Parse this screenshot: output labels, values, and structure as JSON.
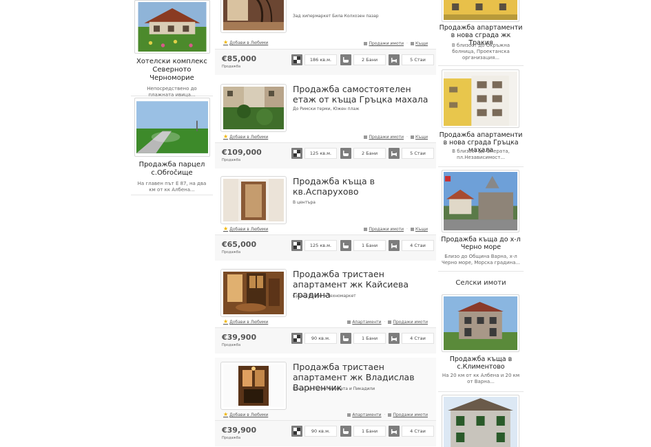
{
  "left_sidebar": [
    {
      "title": "Хотелски комплекс Северното Черноморие",
      "desc": "Непосредствено до плажната ивица..."
    },
    {
      "title": "Продажба парцел с.Обročище",
      "desc": "На главен път Е 87, на два км от кк Албена..."
    }
  ],
  "listings": [
    {
      "title": "",
      "desc": "Зад хипермаркет Била Колхозен пазар",
      "fav": "Добави в Любими",
      "cats": [
        "Продажи имоти",
        "Къщи"
      ],
      "price": "€85,000",
      "price_type": "Продажба",
      "area": "186 кв.м.",
      "baths": "2 Бани",
      "rooms": "5 Стаи"
    },
    {
      "title": "Продажба самостоятелен етаж от къща Гръцка махала",
      "desc": "До Римски терми, Южен плаж",
      "fav": "Добави в Любими",
      "cats": [
        "Продажи имоти",
        "Къщи"
      ],
      "price": "€109,000",
      "price_type": "Продажба",
      "area": "125 кв.м.",
      "baths": "2 Бани",
      "rooms": "5 Стаи"
    },
    {
      "title": "Продажба къща в кв.Аспарухово",
      "desc": "В центъра",
      "fav": "Добави в Любими",
      "cats": [
        "Продажи имоти",
        "Къщи"
      ],
      "price": "€65,000",
      "price_type": "Продажба",
      "area": "125 кв.м.",
      "baths": "1 Бани",
      "rooms": "4 Стаи"
    },
    {
      "title": "Продажба тристаен апартамент жк Кайсиева градина",
      "desc": "Срещу Метро и Техномаркет",
      "fav": "Добави в Любими",
      "cats": [
        "Апартаменти",
        "Продажи имоти"
      ],
      "price": "€39,900",
      "price_type": "Продажба",
      "area": "90 кв.м.",
      "baths": "1 Бани",
      "rooms": "4 Стаи"
    },
    {
      "title": "Продажба тристаен апартамент жк Владислав Варненчик",
      "desc": "Близо до Поликлиниката и Пикадили",
      "fav": "Добави в Любими",
      "cats": [
        "Апартаменти",
        "Продажи имоти"
      ],
      "price": "€39,900",
      "price_type": "Продажба",
      "area": "90 кв.м.",
      "baths": "1 Бани",
      "rooms": "4 Стаи"
    }
  ],
  "right_sidebar": {
    "cards": [
      {
        "title": "Продажба апартаменти в нова сграда жк Тракия",
        "desc": "В близост до Окръжна болница, Проектанска организация..."
      },
      {
        "title": "Продажба апартаменти в нова сграда Гръцка махала",
        "desc": "В близост до Операта, пл.Независимост..."
      },
      {
        "title": "Продажба къща до х-л Черно море",
        "desc": "Близо до Община Варна, х-л Черно море, Морска градина..."
      },
      {
        "title": "Продажба къща в с.Климентово",
        "desc": "На 20 км от кк Албена и 20 км от Варна..."
      }
    ],
    "section_title": "Селски имоти"
  }
}
